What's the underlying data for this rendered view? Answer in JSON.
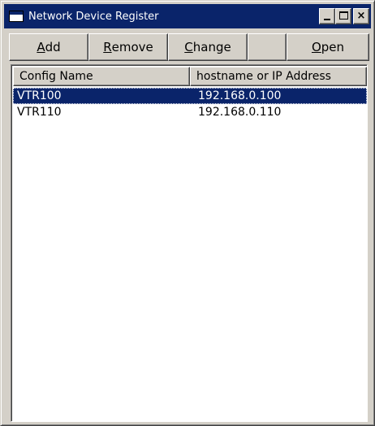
{
  "window": {
    "title": "Network Device Register",
    "titlebar_color": "#0a246a",
    "face_color": "#d4d0c8",
    "selection_color": "#0a246a"
  },
  "caption_buttons": {
    "minimize_icon": "minimize-icon",
    "maximize_icon": "maximize-icon",
    "close_label": "×",
    "close_icon": "close-icon"
  },
  "toolbar": {
    "add": {
      "mnemonic": "A",
      "rest": "dd"
    },
    "remove": {
      "mnemonic": "R",
      "rest": "emove"
    },
    "change": {
      "mnemonic": "C",
      "rest": "hange"
    },
    "open": {
      "mnemonic": "O",
      "rest": "pen"
    }
  },
  "list": {
    "columns": [
      "Config Name",
      "hostname or IP Address"
    ],
    "rows": [
      {
        "config_name": "VTR100",
        "address": "192.168.0.100",
        "selected": true
      },
      {
        "config_name": "VTR110",
        "address": "192.168.0.110",
        "selected": false
      }
    ]
  }
}
